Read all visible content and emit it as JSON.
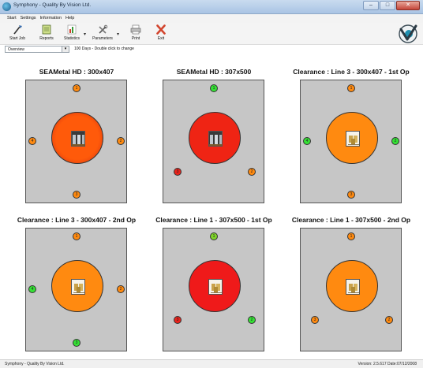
{
  "window": {
    "title": "Symphony - Quality By Vision Ltd.",
    "minimize": "–",
    "maximize": "□",
    "close": "✕"
  },
  "menu": [
    "Start",
    "Settings",
    "Information",
    "Help"
  ],
  "toolbar": {
    "start_job": "Start Job",
    "reports": "Reports",
    "statistics": "Statistics",
    "parameters": "Parameters",
    "print": "Print",
    "exit": "Exit"
  },
  "view": {
    "selected": "Overview",
    "days_hint": "100 Days - Double click to change"
  },
  "colors": {
    "red": "#e8231c",
    "orange": "#ff8a10",
    "green": "#35e035",
    "panel": "#c6c6c6"
  },
  "panels": [
    {
      "title": "SEAMetal HD : 300x407",
      "center_color": "#ff5a0a",
      "ring_color": "#cf2a10",
      "thumb": "metal",
      "dots": [
        {
          "label": "1",
          "color": "#ff8a10"
        },
        {
          "label": "4",
          "color": "#ff8a10"
        },
        {
          "label": "2",
          "color": "#ff8a10"
        },
        {
          "label": "3",
          "color": "#ff8a10"
        }
      ]
    },
    {
      "title": "SEAMetal HD : 307x500",
      "center_color": "#ef2414",
      "ring_color": "#ef2414",
      "thumb": "metal",
      "dots": [
        {
          "label": "1",
          "color": "#35e035"
        },
        {
          "label": "3",
          "color": "#e8231c"
        },
        {
          "label": "2",
          "color": "#ff8a10"
        }
      ]
    },
    {
      "title": "Clearance : Line 3 - 300x407 - 1st Op",
      "center_color": "#ff8a10",
      "ring_color": "#ff8a10",
      "thumb": "cans",
      "dots": [
        {
          "label": "1",
          "color": "#ff8a10"
        },
        {
          "label": "4",
          "color": "#35e035"
        },
        {
          "label": "2",
          "color": "#35e035"
        },
        {
          "label": "3",
          "color": "#ff8a10"
        }
      ]
    },
    {
      "title": "Clearance : Line 3 - 300x407 - 2nd Op",
      "center_color": "#ff8a10",
      "ring_color": "#ff8a10",
      "thumb": "cans",
      "dots": [
        {
          "label": "1",
          "color": "#ff8a10"
        },
        {
          "label": "4",
          "color": "#35e035"
        },
        {
          "label": "2",
          "color": "#ff8a10"
        },
        {
          "label": "3",
          "color": "#35e035"
        }
      ]
    },
    {
      "title": "Clearance : Line 1 - 307x500 - 1st Op",
      "center_color": "#ef1a1a",
      "ring_color": "#ef1a1a",
      "thumb": "cans",
      "dots": [
        {
          "label": "1",
          "color": "#7fd42a"
        },
        {
          "label": "3",
          "color": "#e8231c"
        },
        {
          "label": "2",
          "color": "#35e035"
        }
      ]
    },
    {
      "title": "Clearance : Line 1 - 307x500 - 2nd Op",
      "center_color": "#ff8a10",
      "ring_color": "#ff8a10",
      "thumb": "cans",
      "dots": [
        {
          "label": "1",
          "color": "#ff8a10"
        },
        {
          "label": "3",
          "color": "#ff8a10"
        },
        {
          "label": "2",
          "color": "#ff8a10"
        }
      ]
    }
  ],
  "status": {
    "left": "Symphony - Quality By Vision Ltd.",
    "right": "Version: 2.5.617  Date:07/12/2008"
  }
}
